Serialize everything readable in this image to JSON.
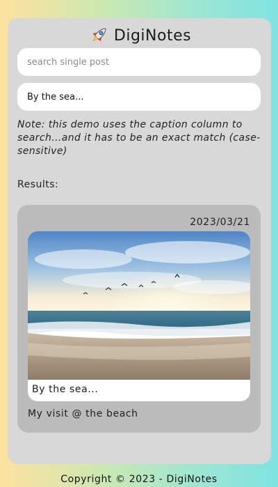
{
  "app": {
    "title": "DigiNotes",
    "logo_icon": "rocket-icon"
  },
  "search": {
    "placeholder": "search single post",
    "value": ""
  },
  "filter": {
    "value": "By the sea..."
  },
  "note": "Note: this demo uses the caption column to search...and it has to be an exact match (case-sensitive)",
  "results": {
    "label": "Results:",
    "posts": [
      {
        "date": "2023/03/21",
        "image": "beach-sunrise-photo",
        "caption": "By the sea...",
        "text": "My visit @ the beach"
      }
    ]
  },
  "footer": {
    "text": "Copyright © 2023 - DigiNotes"
  },
  "colors": {
    "card_bg": "#d8d8d8",
    "post_bg": "#bbbbbb",
    "gradient_left": "#fde2a0",
    "gradient_right": "#7fe3e0"
  }
}
